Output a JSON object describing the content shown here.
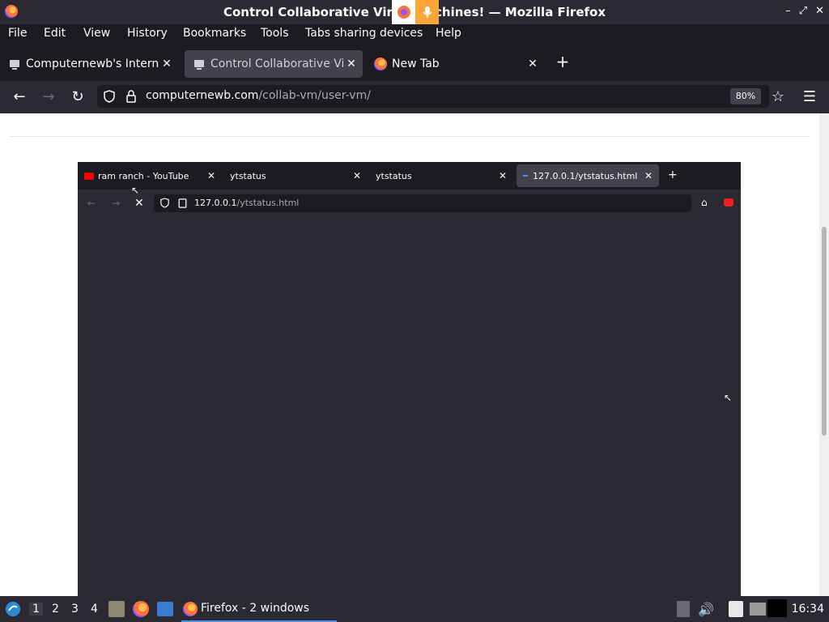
{
  "window": {
    "title": "Control Collaborative Virtual Machines! — Mozilla Firefox",
    "title_visible": "Control Collaborative Virt   chines! — Mozilla Firefox",
    "controls": [
      "–",
      "⤢",
      "✕"
    ]
  },
  "menubar": {
    "items": [
      "File",
      "Edit",
      "View",
      "History",
      "Bookmarks",
      "Tools",
      "Tabs sharing devices",
      "Help"
    ]
  },
  "tabs": [
    {
      "label": "Computernewb's Internet",
      "active": false,
      "icon": "vm-icon"
    },
    {
      "label": "Control Collaborative Virt",
      "active": true,
      "icon": "vm-icon"
    },
    {
      "label": "New Tab",
      "active": false,
      "icon": "firefox-icon"
    }
  ],
  "navbar": {
    "url_host": "computernewb.com",
    "url_path": "/collab-vm/user-vm/",
    "zoom": "80%"
  },
  "vm": {
    "tabs": [
      {
        "label": "ram ranch - YouTube",
        "icon": "youtube-icon",
        "active": false
      },
      {
        "label": "ytstatus",
        "active": false
      },
      {
        "label": "ytstatus",
        "active": false
      },
      {
        "label": "127.0.0.1/ytstatus.html",
        "active": true
      }
    ],
    "url_host": "127.0.0.1",
    "url_path": "/ytstatus.html"
  },
  "taskbar": {
    "workspaces": [
      "1",
      "2",
      "3",
      "4"
    ],
    "active_workspace": "1",
    "task_label": "Firefox - 2 windows",
    "clock": "16:34"
  },
  "colors": {
    "chrome_dark": "#1c1b22",
    "toolbar": "#2b2a33",
    "active_tab": "#42414d",
    "accent": "#4a90e2"
  }
}
